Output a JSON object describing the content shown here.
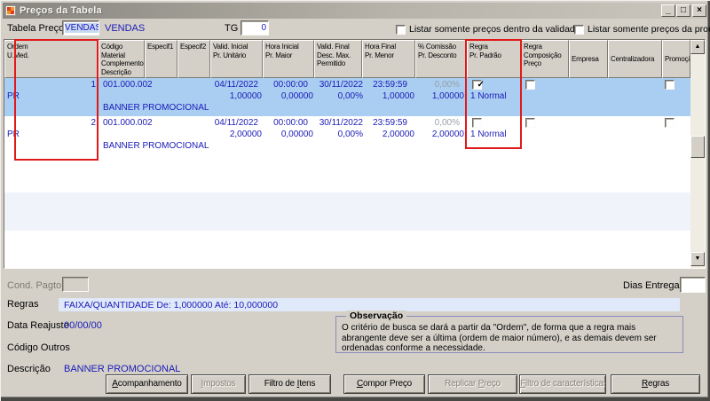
{
  "window": {
    "title": "Preços da Tabela"
  },
  "icons": {
    "minimize": "_",
    "maximize": "□",
    "close": "×",
    "scroll_up": "▲",
    "scroll_down": "▼",
    "check": "✓"
  },
  "topbar": {
    "tabela_preco_label": "Tabela Preço",
    "tabela_preco_value": "VENDAS",
    "tabela_preco_desc": "VENDAS",
    "tg_label": "TG",
    "tg_value": "0",
    "chk_validade_label": "Listar somente preços dentro da validade",
    "chk_promocao_label": "Listar somente preços da promoção"
  },
  "grid": {
    "columns": [
      {
        "label": "Ordem\nU.Med."
      },
      {
        "label": "Código Material\nComplemento\nDescrição"
      },
      {
        "label": "Especif1"
      },
      {
        "label": "Especif2"
      },
      {
        "label": "Valid. Inicial\nPr. Unitário"
      },
      {
        "label": "Hora Inicial\nPr. Maior"
      },
      {
        "label": "Valid. Final\nDesc. Max.\nPermitido"
      },
      {
        "label": "Hora Final\nPr. Menor"
      },
      {
        "label": "% Comissão\nPr. Desconto"
      },
      {
        "label": "Regra\nPr. Padrão"
      },
      {
        "label": "Regra\nComposição\nPreço"
      },
      {
        "label": "Empresa"
      },
      {
        "label": "Centralizadora"
      },
      {
        "label": "Promoção"
      }
    ],
    "rows": [
      {
        "ordem": "1",
        "umed": "PR",
        "codigo": "001.000.002",
        "descricao": "BANNER PROMOCIONAL",
        "valid_inicial": "04/11/2022",
        "hora_inicial": "00:00:00",
        "valid_final": "30/11/2022",
        "hora_final": "23:59:59",
        "comissao": "0,00%",
        "pr_unitario": "1,00000",
        "pr_maior": "0,00000",
        "desc_max": "0,00%",
        "pr_menor": "1,00000",
        "pr_desconto": "1,00000",
        "regra_padrao": "1 Normal",
        "regra_padrao_check": "✓",
        "regra_comp_check": "",
        "promocao_check": ""
      },
      {
        "ordem": "2",
        "umed": "PR",
        "codigo": "001.000.002",
        "descricao": "BANNER PROMOCIONAL",
        "valid_inicial": "04/11/2022",
        "hora_inicial": "00:00:00",
        "valid_final": "30/11/2022",
        "hora_final": "23:59:59",
        "comissao": "0,00%",
        "pr_unitario": "2,00000",
        "pr_maior": "0,00000",
        "desc_max": "0,00%",
        "pr_menor": "2,00000",
        "pr_desconto": "2,00000",
        "regra_padrao": "1 Normal",
        "regra_padrao_check": "",
        "regra_comp_check": "",
        "promocao_check": ""
      }
    ]
  },
  "footer": {
    "cond_pagto_label": "Cond. Pagto.",
    "dias_entrega_label": "Dias Entrega",
    "dias_entrega_value": "",
    "regras_label": "Regras",
    "regras_value": "FAIXA/QUANTIDADE De: 1,000000 Até: 10,000000",
    "data_reajuste_label": "Data Reajuste",
    "data_reajuste_value": "00/00/00",
    "codigo_outros_label": "Código Outros",
    "codigo_outros_value": "",
    "descricao_label": "Descrição",
    "descricao_value": "BANNER PROMOCIONAL",
    "observacao_title": "Observação",
    "observacao_text": "O critério de busca se dará a partir da \"Ordem\", de forma que a regra mais abrangente deve ser a última (ordem de maior número), e as demais devem ser ordenadas conforme a necessidade."
  },
  "buttons": [
    {
      "pre": "",
      "key": "A",
      "post": "companhamento",
      "enabled": true
    },
    {
      "pre": "",
      "key": "I",
      "post": "mpostos",
      "enabled": false
    },
    {
      "pre": "Filtro de ",
      "key": "I",
      "post": "tens",
      "enabled": true
    },
    {
      "pre": "",
      "key": "C",
      "post": "ompor Preço",
      "enabled": true
    },
    {
      "pre": "Replicar ",
      "key": "P",
      "post": "reço",
      "enabled": false
    },
    {
      "pre": "",
      "key": "F",
      "post": "iltro de características",
      "enabled": false
    },
    {
      "pre": "",
      "key": "R",
      "post": "egras",
      "enabled": true
    }
  ],
  "colors": {
    "selected_row": "#a9cef1",
    "stripe_row": "#f0f3fa",
    "data_text": "#1a1ab8",
    "annotation_red": "#e01a1a"
  }
}
